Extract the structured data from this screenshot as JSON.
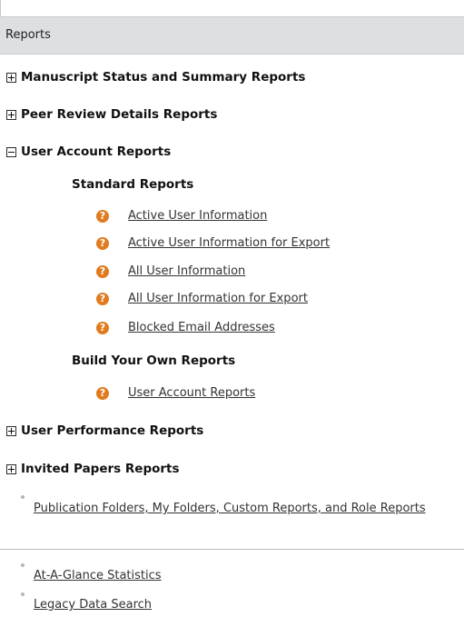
{
  "header": {
    "title": "Reports"
  },
  "sections": [
    {
      "label": "Manuscript Status and Summary Reports",
      "state": "collapsed"
    },
    {
      "label": "Peer Review Details Reports",
      "state": "collapsed"
    },
    {
      "label": "User Account Reports",
      "state": "expanded"
    },
    {
      "label": "User Performance Reports",
      "state": "collapsed"
    },
    {
      "label": "Invited Papers Reports",
      "state": "collapsed"
    }
  ],
  "user_account": {
    "standard_heading": "Standard Reports",
    "standard_reports": [
      "Active User Information",
      "Active User Information for Export",
      "All User Information",
      "All User Information for Export",
      "Blocked Email Addresses"
    ],
    "build_heading": "Build Your Own Reports",
    "build_reports": [
      "User Account Reports"
    ]
  },
  "help_icon_glyph": "?",
  "links": {
    "publication_folders": "Publication Folders, My Folders, Custom Reports, and Role Reports",
    "at_a_glance": "At-A-Glance Statistics",
    "legacy_search": "Legacy Data Search"
  },
  "colors": {
    "header_bg": "#dddfe3",
    "help_icon": "#e07b1f",
    "link": "#333333"
  }
}
